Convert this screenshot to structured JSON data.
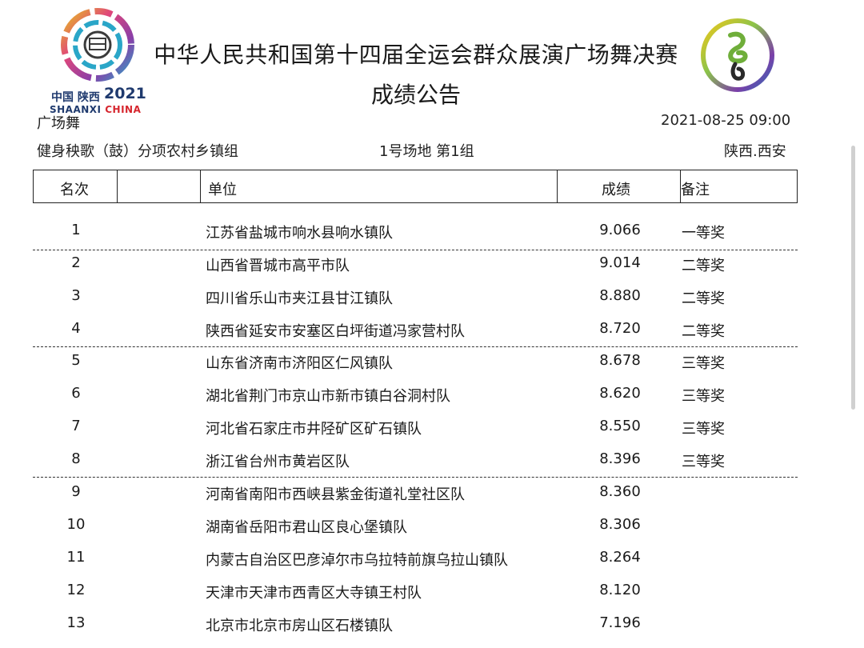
{
  "logo_left": {
    "brand_cn": "中国 陕西",
    "brand_year": "2021",
    "brand_en_a": "SHAANXI",
    "brand_en_b": "CHINA"
  },
  "header": {
    "title": "中华人民共和国第十四届全运会群众展演广场舞决赛",
    "subtitle": "成绩公告"
  },
  "meta": {
    "category": "广场舞",
    "datetime": "2021-08-25 09:00",
    "event": "健身秧歌（鼓）分项农村乡镇组",
    "venue": "1号场地 第1组",
    "location": "陕西.西安"
  },
  "table": {
    "columns": [
      "名次",
      "单位",
      "成绩",
      "备注"
    ],
    "rows": [
      {
        "rank": "1",
        "unit": "江苏省盐城市响水县响水镇队",
        "score": "9.066",
        "remark": "一等奖"
      },
      {
        "rank": "2",
        "unit": "山西省晋城市高平市队",
        "score": "9.014",
        "remark": "二等奖"
      },
      {
        "rank": "3",
        "unit": "四川省乐山市夹江县甘江镇队",
        "score": "8.880",
        "remark": "二等奖"
      },
      {
        "rank": "4",
        "unit": "陕西省延安市安塞区白坪街道冯家营村队",
        "score": "8.720",
        "remark": "二等奖"
      },
      {
        "rank": "5",
        "unit": "山东省济南市济阳区仁风镇队",
        "score": "8.678",
        "remark": "三等奖"
      },
      {
        "rank": "6",
        "unit": "湖北省荆门市京山市新市镇白谷洞村队",
        "score": "8.620",
        "remark": "三等奖"
      },
      {
        "rank": "7",
        "unit": "河北省石家庄市井陉矿区矿石镇队",
        "score": "8.550",
        "remark": "三等奖"
      },
      {
        "rank": "8",
        "unit": "浙江省台州市黄岩区队",
        "score": "8.396",
        "remark": "三等奖"
      },
      {
        "rank": "9",
        "unit": "河南省南阳市西峡县紫金街道礼堂社区队",
        "score": "8.360",
        "remark": ""
      },
      {
        "rank": "10",
        "unit": "湖南省岳阳市君山区良心堡镇队",
        "score": "8.306",
        "remark": ""
      },
      {
        "rank": "11",
        "unit": "内蒙古自治区巴彦淖尔市乌拉特前旗乌拉山镇队",
        "score": "8.264",
        "remark": ""
      },
      {
        "rank": "12",
        "unit": "天津市天津市西青区大寺镇王村队",
        "score": "8.120",
        "remark": ""
      },
      {
        "rank": "13",
        "unit": "北京市北京市房山区石楼镇队",
        "score": "7.196",
        "remark": ""
      }
    ]
  },
  "icons": {
    "logo_left": "games-emblem-icon",
    "logo_right": "mascot-emblem-icon"
  }
}
